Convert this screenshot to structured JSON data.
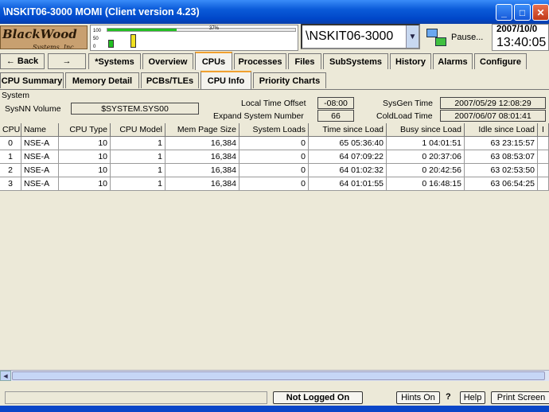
{
  "window": {
    "title": "\\NSKIT06-3000 MOMI (Client version 4.23)",
    "min": "_",
    "max": "□",
    "close": "✕"
  },
  "header": {
    "logo_main": "BlackWood",
    "logo_sub": "Systems, Inc.",
    "meter_scale": [
      "100",
      "50",
      "0"
    ],
    "meter_pct_label": "37%",
    "meter_value": 0.37,
    "system_name": "\\NSKIT06-3000",
    "pause_label": "Pause...",
    "date": "2007/10/0",
    "time": "13:40:05"
  },
  "nav": {
    "back_label": "← Back",
    "forward_label": "→",
    "tabs": [
      "*Systems",
      "Overview",
      "CPUs",
      "Processes",
      "Files",
      "SubSystems",
      "History",
      "Alarms",
      "Configure"
    ],
    "active_tab": "CPUs"
  },
  "subtabs": {
    "items": [
      "CPU Summary",
      "Memory Detail",
      "PCBs/TLEs",
      "CPU Info",
      "Priority Charts"
    ],
    "active": "CPU Info"
  },
  "system": {
    "section_label": "System",
    "sysnn_label": "SysNN Volume",
    "sysnn_value": "$SYSTEM.SYS00",
    "lto_label": "Local Time Offset",
    "lto_value": "-08:00",
    "esn_label": "Expand System Number",
    "esn_value": "66",
    "sysgen_label": "SysGen Time",
    "sysgen_value": "2007/05/29 12:08:29",
    "coldload_label": "ColdLoad Time",
    "coldload_value": "2007/06/07 08:01:41"
  },
  "table": {
    "columns": [
      "CPU",
      "Name",
      "CPU Type",
      "CPU Model",
      "Mem Page Size",
      "System Loads",
      "Time since Load",
      "Busy since Load",
      "Idle since Load",
      "I"
    ],
    "rows": [
      [
        "0",
        "NSE-A",
        "10",
        "1",
        "16,384",
        "0",
        "65 05:36:40",
        "1 04:01:51",
        "63 23:15:57",
        ""
      ],
      [
        "1",
        "NSE-A",
        "10",
        "1",
        "16,384",
        "0",
        "64 07:09:22",
        "0 20:37:06",
        "63 08:53:07",
        ""
      ],
      [
        "2",
        "NSE-A",
        "10",
        "1",
        "16,384",
        "0",
        "64 01:02:32",
        "0 20:42:56",
        "63 02:53:50",
        ""
      ],
      [
        "3",
        "NSE-A",
        "10",
        "1",
        "16,384",
        "0",
        "64 01:01:55",
        "0 16:48:15",
        "63 06:54:25",
        ""
      ]
    ]
  },
  "statusbar": {
    "login_status": "Not Logged On",
    "hints_label": "Hints On",
    "question": "?",
    "help_label": "Help",
    "print_label": "Print Screen"
  },
  "colors": {
    "titlebar": "#0a5ad8",
    "meter_fill": "#22c022",
    "active_tab_accent": "#f0a030"
  }
}
